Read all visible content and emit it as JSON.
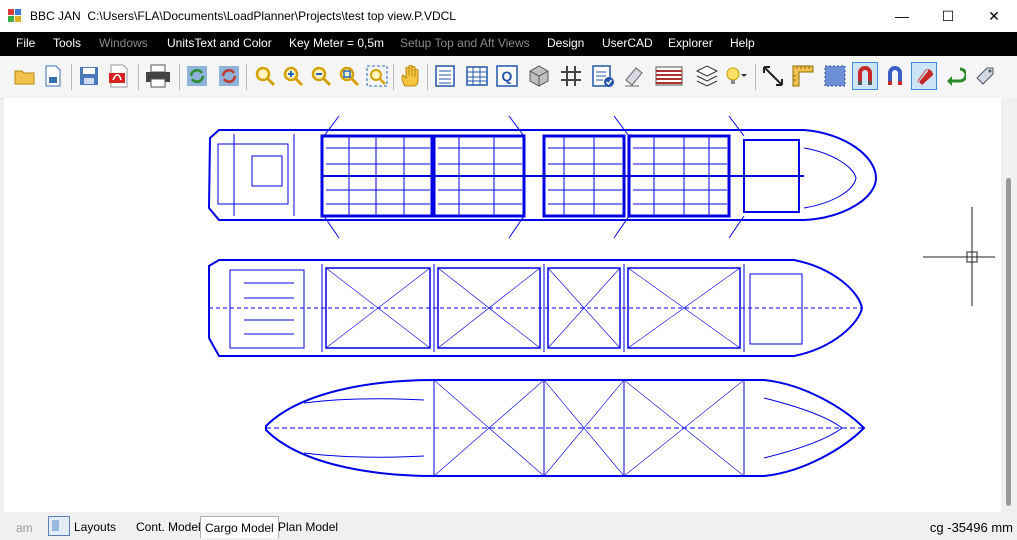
{
  "window": {
    "app_name": "BBC JAN",
    "file_path": "C:\\Users\\FLA\\Documents\\LoadPlanner\\Projects\\test top view.P.VDCL",
    "minimize": "—",
    "maximize": "☐",
    "close": "✕"
  },
  "menu": {
    "items": [
      {
        "label": "File",
        "enabled": true
      },
      {
        "label": "Tools",
        "enabled": true
      },
      {
        "label": "Windows",
        "enabled": false
      },
      {
        "label": "UnitsText and Color",
        "enabled": true
      },
      {
        "label": "Key Meter = 0,5m",
        "enabled": true
      },
      {
        "label": "Setup Top and Aft Views",
        "enabled": false
      },
      {
        "label": "Design",
        "enabled": true
      },
      {
        "label": "UserCAD",
        "enabled": true
      },
      {
        "label": "Explorer",
        "enabled": true
      },
      {
        "label": "Help",
        "enabled": true
      }
    ]
  },
  "toolbar": {
    "icons": [
      "open-folder-icon",
      "new-document-icon",
      "save-icon",
      "pdf-icon",
      "print-icon",
      "refresh-icon",
      "refresh-all-icon",
      "zoom-icon",
      "zoom-in-icon",
      "zoom-out-icon",
      "zoom-fit-icon",
      "zoom-window-icon",
      "pan-hand-icon",
      "list-view-icon",
      "table-icon",
      "query-icon",
      "3d-box-icon",
      "grid-icon",
      "checklist-icon",
      "eraser-icon",
      "hatch-icon",
      "layers-icon",
      "lightbulb-icon",
      "measure-icon",
      "ruler-icon",
      "select-region-icon",
      "magnet-red-icon",
      "magnet-blue-icon",
      "magnet-icon",
      "undo-arrow-icon",
      "tag-icon"
    ],
    "active": [
      "magnet-red-icon",
      "magnet-icon"
    ]
  },
  "statusbar": {
    "left_text": "am",
    "tabs": [
      {
        "label": "Layouts",
        "selected": false
      },
      {
        "label": "Cont. Model",
        "selected": false
      },
      {
        "label": "Cargo Model",
        "selected": true
      },
      {
        "label": "Plan Model",
        "selected": false
      }
    ],
    "right_text": "cg -35496 mm"
  },
  "colors": {
    "drawing_line": "#0000e6",
    "menubar_bg": "#000000",
    "canvas_bg": "#ffffff"
  }
}
